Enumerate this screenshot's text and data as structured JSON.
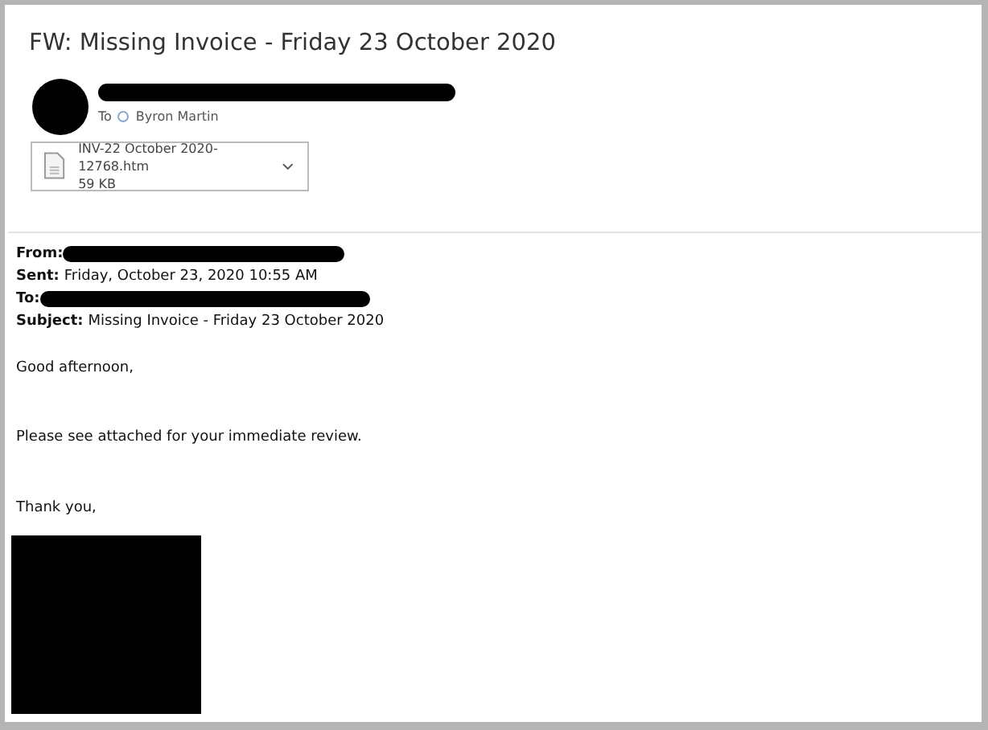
{
  "message": {
    "title": "FW: Missing Invoice - Friday 23 October 2020",
    "to_label": "To",
    "recipient": "Byron Martin",
    "attachment": {
      "name": "INV-22 October 2020-12768.htm",
      "size": "59 KB"
    }
  },
  "forwarded_header": [
    {
      "label": "From:",
      "kind": "redacted"
    },
    {
      "label": "Sent:",
      "kind": "text",
      "value": "Friday, October 23, 2020 10:55 AM"
    },
    {
      "label": "To:",
      "kind": "redacted"
    },
    {
      "label": "Subject:",
      "kind": "text",
      "value": "Missing Invoice - Friday 23 October 2020"
    }
  ],
  "body": [
    "Good afternoon,",
    "Please see attached for your immediate review.",
    "Thank you,"
  ]
}
